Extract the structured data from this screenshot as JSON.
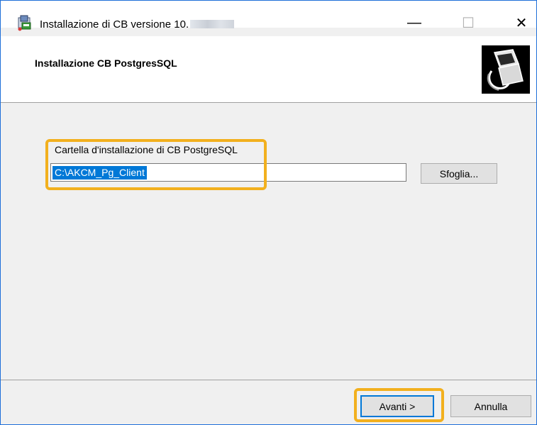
{
  "window": {
    "title_prefix": "Installazione di CB versione 10.",
    "minimize_glyph": "—",
    "maximize_glyph": "☐",
    "close_glyph": "✕"
  },
  "header": {
    "title": "Installazione CB PostgresSQL"
  },
  "form": {
    "field_label": "Cartella d'installazione di CB PostgreSQL",
    "field_value": "C:\\AKCM_Pg_Client",
    "browse_label": "Sfoglia..."
  },
  "footer": {
    "next_label": "Avanti >",
    "cancel_label": "Annulla"
  },
  "colors": {
    "highlight": "#f2b01e",
    "selection": "#0078d7",
    "window_border": "#1e6fd9"
  },
  "icons": [
    "installer-icon",
    "installer-logo-icon"
  ]
}
